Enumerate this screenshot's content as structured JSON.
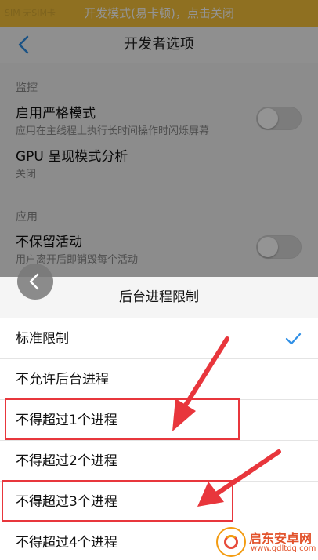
{
  "status_bar": {
    "ghost_text": "SIM 无SIM卡"
  },
  "dev_banner": "开发模式(易卡顿)，点击关闭",
  "nav": {
    "title": "开发者选项"
  },
  "sections": {
    "monitor": {
      "label": "监控",
      "strict_mode": {
        "title": "启用严格模式",
        "subtitle": "应用在主线程上执行长时间操作时闪烁屏幕",
        "enabled": false
      },
      "gpu_profile": {
        "title": "GPU 呈现模式分析",
        "subtitle": "关闭"
      }
    },
    "apps": {
      "label": "应用",
      "dont_keep": {
        "title": "不保留活动",
        "subtitle": "用户离开后即销毁每个活动",
        "enabled": false
      }
    }
  },
  "sheet": {
    "title": "后台进程限制",
    "options": [
      {
        "label": "标准限制",
        "selected": true
      },
      {
        "label": "不允许后台进程",
        "selected": false
      },
      {
        "label": "不得超过1个进程",
        "selected": false
      },
      {
        "label": "不得超过2个进程",
        "selected": false
      },
      {
        "label": "不得超过3个进程",
        "selected": false
      },
      {
        "label": "不得超过4个进程",
        "selected": false
      }
    ]
  },
  "colors": {
    "banner": "#f6c23a",
    "accent_check": "#2f8fe6",
    "annotation": "#e8363c"
  },
  "icons": {
    "back": "chevron-left-icon",
    "float_back": "chevron-left-icon",
    "check": "checkmark-icon"
  },
  "watermark": {
    "title": "启东安卓网",
    "url": "www.qdltdq.com"
  }
}
